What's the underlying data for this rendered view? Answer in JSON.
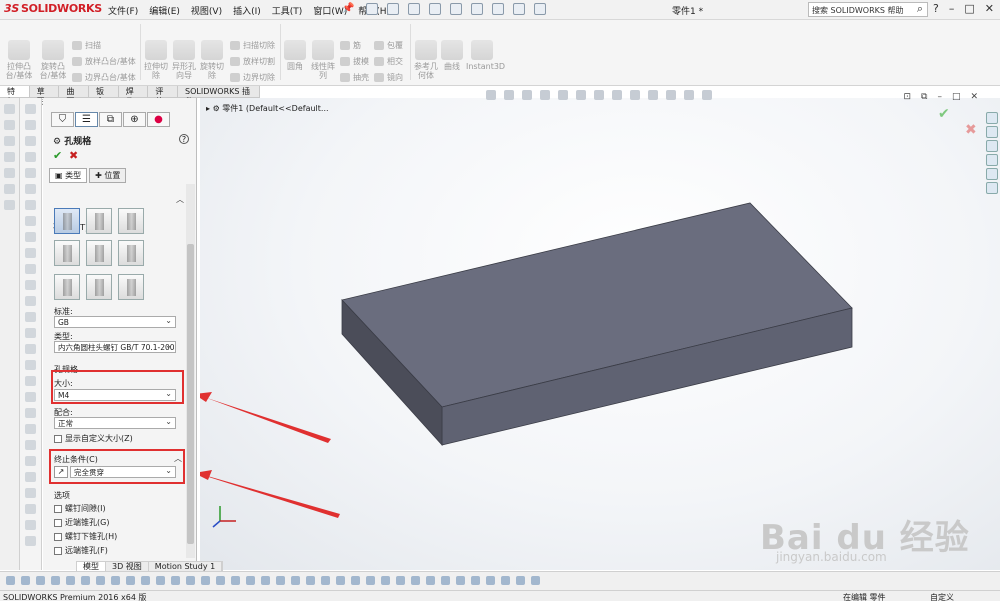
{
  "app": {
    "logo_mark": "3S",
    "logo_text": "SOLIDWORKS"
  },
  "menus": [
    "文件(F)",
    "编辑(E)",
    "视图(V)",
    "插入(I)",
    "工具(T)",
    "窗口(W)",
    "帮助(H)"
  ],
  "document_title": "零件1 *",
  "search": {
    "text": "搜索 SOLIDWORKS 帮助"
  },
  "window_buttons": [
    "?",
    "–",
    "□",
    "✕"
  ],
  "ribbon": {
    "big_buttons": [
      "拉伸凸台/基体",
      "旋转凸台/基体",
      "拉伸切除",
      "异形孔向导",
      "旋转切除",
      "圆角",
      "线性阵列",
      "参考几何体",
      "曲线",
      "Instant3D"
    ],
    "small_buttons": [
      "扫描",
      "放样凸台/基体",
      "边界凸台/基体",
      "扫描切除",
      "放样切割",
      "边界切除",
      "筋",
      "拔模",
      "抽壳",
      "包覆",
      "相交",
      "镜向"
    ]
  },
  "tabs": [
    "特征",
    "草图",
    "曲面",
    "钣金",
    "焊件",
    "评估",
    "SOLIDWORKS 插件"
  ],
  "property_manager": {
    "title": "孔规格",
    "help": "?",
    "subtabs": [
      "类型",
      "位置"
    ],
    "hole_type_label": "孔类型(T)",
    "standard_label": "标准:",
    "standard_value": "GB",
    "type_label": "类型:",
    "type_value": "内六角圆柱头螺钉 GB/T 70.1-2000",
    "hole_spec_label": "孔规格",
    "size_label": "大小:",
    "size_value": "M4",
    "fit_label": "配合:",
    "fit_value": "正常",
    "custom_size_label": "显示自定义大小(Z)",
    "end_condition_label": "终止条件(C)",
    "end_condition_value": "完全贯穿",
    "options_label": "选项",
    "options": [
      "螺钉间隙(I)",
      "近端锥孔(G)",
      "螺钉下锥孔(H)",
      "远端锥孔(F)"
    ]
  },
  "viewport": {
    "tree_item": "零件1  (Default<<Default..."
  },
  "watermark": {
    "main": "Bai du 经验",
    "sub": "jingyan.baidu.com"
  },
  "bottom_tabs": [
    "模型",
    "3D 视图",
    "Motion Study 1"
  ],
  "status": {
    "left": "SOLIDWORKS Premium 2016 x64 版",
    "mode": "在编辑 零件",
    "custom": "自定义"
  },
  "colors": {
    "box_top": "#6a6d7e",
    "box_front": "#5f6272",
    "box_side": "#4b4d59",
    "highlight": "#e03030",
    "logo_red": "#d11f26"
  }
}
